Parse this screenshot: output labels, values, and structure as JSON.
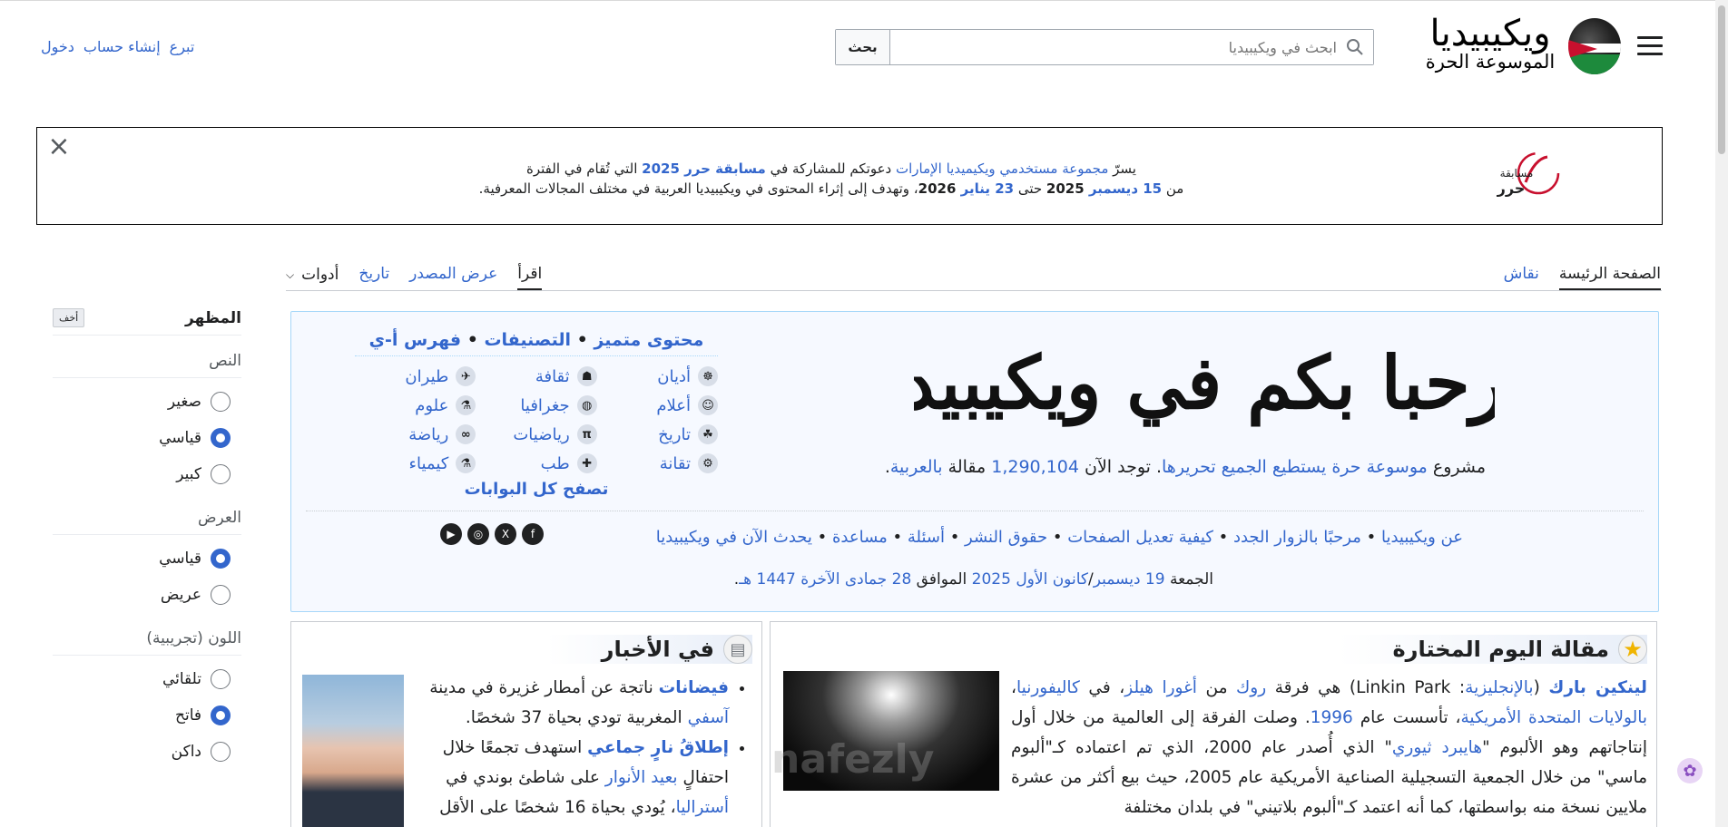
{
  "header": {
    "wordmark_title": "ويكيبيديا",
    "wordmark_tagline": "الموسوعة الحرة",
    "search_placeholder": "ابحث في ويكيبيديا",
    "search_button": "بحث",
    "user_links": [
      "تبرع",
      "إنشاء حساب",
      "دخول"
    ]
  },
  "banner": {
    "line1": [
      {
        "t": "يسرّ ",
        "b": false,
        "link": false
      },
      {
        "t": "مجموعة مستخدمي ويكيميديا الإمارات",
        "b": false,
        "link": true
      },
      {
        "t": " دعوتكم للمشاركة في ",
        "b": false,
        "link": false
      },
      {
        "t": "مسابقة حرر 2025",
        "b": true,
        "link": true
      },
      {
        "t": " التي تُقام في الفترة",
        "b": false,
        "link": false
      }
    ],
    "line2": [
      {
        "t": "من ",
        "b": false,
        "link": false
      },
      {
        "t": "15 ديسمبر",
        "b": true,
        "link": true
      },
      {
        "t": " 2025",
        "b": true,
        "link": false
      },
      {
        "t": " حتى ",
        "b": false,
        "link": false
      },
      {
        "t": "23 يناير",
        "b": true,
        "link": true
      },
      {
        "t": " 2026",
        "b": true,
        "link": false
      },
      {
        "t": "، وتهدف إلى إثراء المحتوى في ويكيبيديا العربية في مختلف المجالات المعرفية.",
        "b": false,
        "link": false
      }
    ],
    "logo_text": "مسابقة حرر"
  },
  "tabs": {
    "page": [
      {
        "label": "الصفحة الرئيسة",
        "selected": true
      },
      {
        "label": "نقاش",
        "selected": false
      }
    ],
    "views": [
      {
        "label": "اقرأ",
        "selected": true
      },
      {
        "label": "عرض المصدر",
        "selected": false
      },
      {
        "label": "تاريخ",
        "selected": false
      }
    ],
    "tools": "أدوات"
  },
  "appearance": {
    "title": "المظهر",
    "hide": "أخف",
    "sections": [
      {
        "label": "النص",
        "options": [
          {
            "label": "صغير",
            "checked": false
          },
          {
            "label": "قياسي",
            "checked": true
          },
          {
            "label": "كبير",
            "checked": false
          }
        ]
      },
      {
        "label": "العرض",
        "options": [
          {
            "label": "قياسي",
            "checked": true
          },
          {
            "label": "عريض",
            "checked": false
          }
        ]
      },
      {
        "label": "اللون (تجريبية)",
        "options": [
          {
            "label": "تلقائي",
            "checked": false
          },
          {
            "label": "فاتح",
            "checked": true
          },
          {
            "label": "داكن",
            "checked": false
          }
        ]
      }
    ]
  },
  "welcome": {
    "heading": "مرحبا بكم في ويكيبيديا",
    "intro": [
      {
        "t": "مشروع ",
        "link": false
      },
      {
        "t": "موسوعة",
        "link": true
      },
      {
        "t": " ",
        "link": false
      },
      {
        "t": "حرة",
        "link": true
      },
      {
        "t": " ",
        "link": false
      },
      {
        "t": "يستطيع الجميع تحريرها",
        "link": true
      },
      {
        "t": ". توجد الآن ",
        "link": false
      },
      {
        "t": "1,290,104",
        "link": true
      },
      {
        "t": " مقالة ",
        "link": false
      },
      {
        "t": "بالعربية",
        "link": true
      },
      {
        "t": ".",
        "link": false
      }
    ],
    "portal_links": [
      "محتوى متميز",
      "التصنيفات",
      "فهرس أ-ي"
    ],
    "portals": [
      {
        "label": "أديان",
        "icon": "religion-icon",
        "glyph": "☸"
      },
      {
        "label": "ثقافة",
        "icon": "culture-icon",
        "glyph": "☗"
      },
      {
        "label": "طيران",
        "icon": "aviation-icon",
        "glyph": "✈"
      },
      {
        "label": "أعلام",
        "icon": "people-icon",
        "glyph": "☺"
      },
      {
        "label": "جغرافيا",
        "icon": "globe-icon",
        "glyph": "◍"
      },
      {
        "label": "علوم",
        "icon": "flask-icon",
        "glyph": "⚗"
      },
      {
        "label": "تاريخ",
        "icon": "history-icon",
        "glyph": "☘"
      },
      {
        "label": "رياضيات",
        "icon": "pi-icon",
        "glyph": "π"
      },
      {
        "label": "رياضة",
        "icon": "olympic-icon",
        "glyph": "∞"
      },
      {
        "label": "تقانة",
        "icon": "technology-icon",
        "glyph": "⚙"
      },
      {
        "label": "طب",
        "icon": "medicine-icon",
        "glyph": "✚"
      },
      {
        "label": "كيمياء",
        "icon": "chemistry-icon",
        "glyph": "⚗"
      }
    ],
    "browse_all": "تصفح كل البوابات",
    "help_links": [
      "عن ويكيبيديا",
      "مرحبًا بالزوار الجدد",
      "كيفية تعديل الصفحات",
      "حقوق النشر",
      "أسئلة",
      "مساعدة",
      "يحدث الآن في ويكيبيديا"
    ],
    "social": [
      "f",
      "X",
      "◎",
      "▶"
    ],
    "date": [
      {
        "t": "الجمعة ",
        "link": false
      },
      {
        "t": "19 ديسمبر",
        "link": true
      },
      {
        "t": "/",
        "link": false
      },
      {
        "t": "كانون الأول",
        "link": true
      },
      {
        "t": " ",
        "link": false
      },
      {
        "t": "2025",
        "link": true
      },
      {
        "t": " الموافق ",
        "link": false
      },
      {
        "t": "28 جمادى الآخرة 1447 هـ",
        "link": true
      },
      {
        "t": ".",
        "link": false
      }
    ]
  },
  "featured": {
    "title": "مقالة اليوم المختارة",
    "text": [
      {
        "t": "لينكين بارك",
        "link": true,
        "b": true
      },
      {
        "t": " (",
        "link": false
      },
      {
        "t": "بالإنجليزية",
        "link": true
      },
      {
        "t": ": Linkin Park) هي فرقة ",
        "link": false
      },
      {
        "t": "روك",
        "link": true
      },
      {
        "t": " من ",
        "link": false
      },
      {
        "t": "أغورا هيلز",
        "link": true
      },
      {
        "t": "، في ",
        "link": false
      },
      {
        "t": "كاليفورنيا",
        "link": true
      },
      {
        "t": "، ",
        "link": false
      },
      {
        "t": "بالولايات المتحدة الأمريكية",
        "link": true
      },
      {
        "t": "، تأسست عام ",
        "link": false
      },
      {
        "t": "1996",
        "link": true
      },
      {
        "t": ". وصلت الفرقة إلى العالمية من خلال أول إنتاجاتهم وهو الألبوم \"",
        "link": false
      },
      {
        "t": "هايبرد ثيوري",
        "link": true
      },
      {
        "t": "\" الذي أُصدر عام 2000، الذي تم اعتماده كـ\"ألبوم ماسي\" من خلال الجمعية التسجيلية الصناعية الأمريكية عام 2005، حيث بيع أكثر من عشرة ملايين نسخة منه بواسطتها، كما أنه اعتمد كـ\"ألبوم بلاتيني\" في بلدان مختلفة",
        "link": false
      }
    ]
  },
  "news": {
    "title": "في الأخبار",
    "items": [
      [
        {
          "t": "فيضانات",
          "link": true,
          "b": true
        },
        {
          "t": " ناتجة عن أمطار غزيرة في مدينة ",
          "link": false
        },
        {
          "t": "آسفي",
          "link": true
        },
        {
          "t": " المغربية تودي بحياة 37 شخصًا.",
          "link": false
        }
      ],
      [
        {
          "t": "إطلاقُ نارٍ جماعي",
          "link": true,
          "b": true
        },
        {
          "t": " استهدف تجمعًا خلال احتفالٍ ",
          "link": false
        },
        {
          "t": "بعيد الأنوار",
          "link": true
        },
        {
          "t": " على شاطئ بوندي في ",
          "link": false
        },
        {
          "t": "أستراليا",
          "link": true
        },
        {
          "t": "، يُودي بحياة 16 شخصًا على الأقل",
          "link": false
        }
      ]
    ]
  }
}
